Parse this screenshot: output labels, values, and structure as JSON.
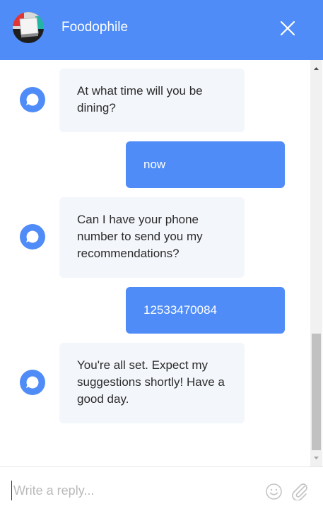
{
  "header": {
    "title": "Foodophile",
    "colors": {
      "background": "#4f8cf7",
      "text": "#ffffff"
    },
    "icons": {
      "avatar": "foodophile-logo",
      "close": "close-icon"
    }
  },
  "messages": [
    {
      "sender": "bot",
      "text": "At what time will you be dining?"
    },
    {
      "sender": "user",
      "text": "now"
    },
    {
      "sender": "bot",
      "text": "Can I have your phone number to send you my recommendations?"
    },
    {
      "sender": "user",
      "text": "12533470084"
    },
    {
      "sender": "bot",
      "text": "You're all set. Expect my suggestions shortly! Have a good day."
    }
  ],
  "composer": {
    "placeholder": "Write a reply...",
    "value": "",
    "icons": {
      "emoji": "smiley-icon",
      "attach": "paperclip-icon"
    }
  },
  "theme": {
    "accent": "#4f8cf7",
    "bot_bubble": "#f3f6fa"
  }
}
